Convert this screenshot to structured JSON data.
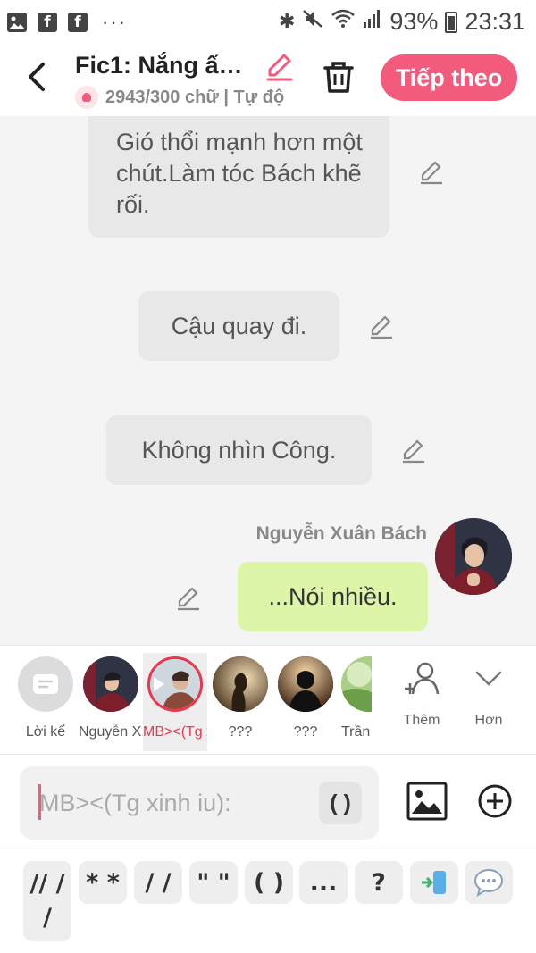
{
  "status_bar": {
    "left_icons": [
      "image-icon",
      "facebook-icon",
      "facebook-icon"
    ],
    "more": "···",
    "battery": "93%",
    "time": "23:31"
  },
  "header": {
    "title": "Fic1: Nắng ấ…",
    "subtitle": "2943/300 chữ | Tự độ",
    "next_label": "Tiếp theo",
    "accent": "#f25b7b"
  },
  "chat": {
    "messages": [
      {
        "text": "Gió thổi mạnh hơn một chút.Làm tóc Bách khẽ rối."
      },
      {
        "text": "Cậu quay đi."
      },
      {
        "text": "Không nhìn Công."
      },
      {
        "sender": "Nguyễn Xuân Bách",
        "text": "...Nói nhiều."
      }
    ]
  },
  "characters": {
    "items": [
      {
        "label": "Lời kể"
      },
      {
        "label": "Nguyễn X..."
      },
      {
        "label": "MB><(Tg x..."
      },
      {
        "label": "???"
      },
      {
        "label": "???"
      },
      {
        "label": "Trần T"
      }
    ],
    "add_label": "Thêm",
    "more_label": "Hơn"
  },
  "input": {
    "placeholder": "MB><(Tg xinh iu):",
    "paren_button": "( )"
  },
  "symbols": [
    "// /\n/",
    "* *",
    "/ /",
    "\" \"",
    "( )",
    "...",
    "?"
  ]
}
